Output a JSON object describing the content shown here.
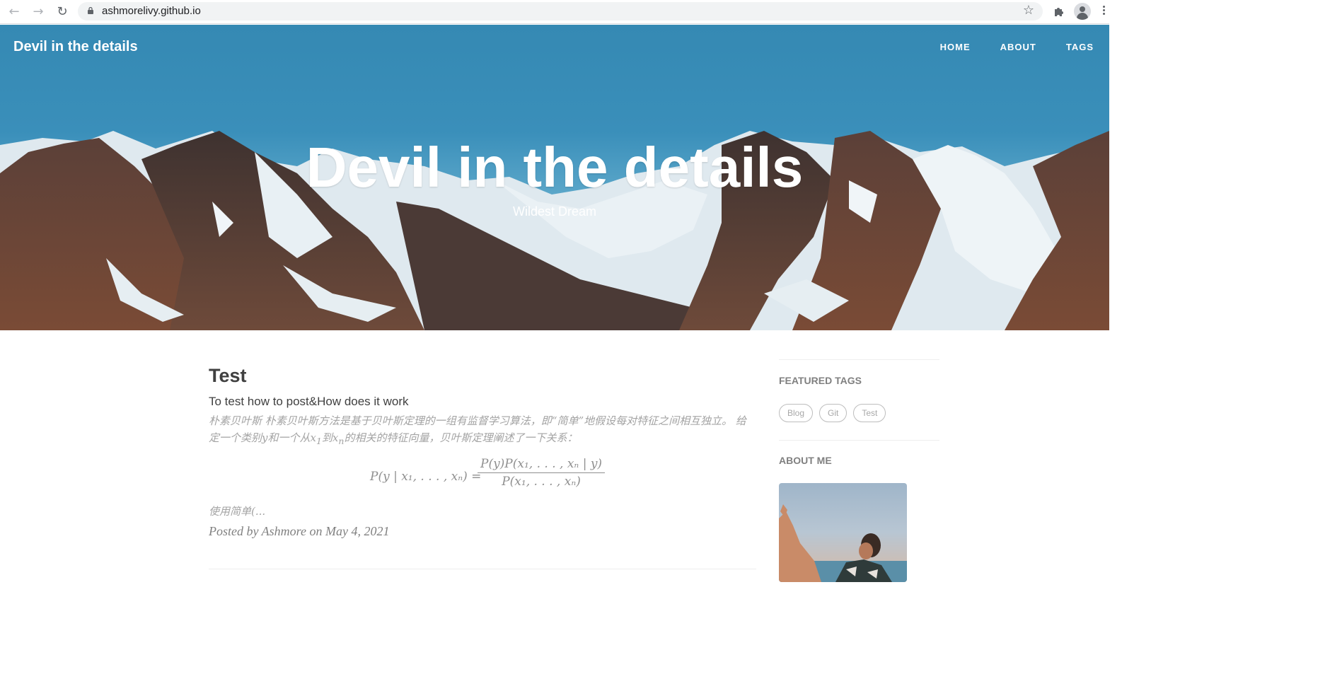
{
  "browser": {
    "url": "ashmorelivy.github.io"
  },
  "site": {
    "brand": "Devil in the details",
    "nav": [
      "HOME",
      "ABOUT",
      "TAGS"
    ],
    "hero_title": "Devil in the details",
    "hero_subtitle": "Wildest Dream"
  },
  "post": {
    "title": "Test",
    "subtitle": "To test how to post&How does it work",
    "excerpt_part1": "朴素贝叶斯 朴素贝叶斯方法是基于贝叶斯定理的一组有监督学习算法，即“简单”地假设每对特征之间相互独立。 给定一个类别y和一个从",
    "excerpt_x1": "x",
    "excerpt_x1_sub": "1",
    "excerpt_to": "到",
    "excerpt_xn": "x",
    "excerpt_xn_sub": "n",
    "excerpt_part2": "的相关的特征向量，贝叶斯定理阐述了一下关系：",
    "formula_lhs": "P(y | x₁, . . . , xₙ) =",
    "formula_num": "P(y)P(x₁, . . . , xₙ | y)",
    "formula_den": "P(x₁, . . . , xₙ)",
    "more": "使用简单(...",
    "meta": "Posted by Ashmore on May 4, 2021"
  },
  "sidebar": {
    "featured_tags_heading": "FEATURED TAGS",
    "tags": [
      "Blog",
      "Git",
      "Test"
    ],
    "about_heading": "ABOUT ME"
  },
  "colors": {
    "sky": "#3589b3",
    "text_dark": "#404040",
    "text_muted": "#a3a3a3"
  }
}
